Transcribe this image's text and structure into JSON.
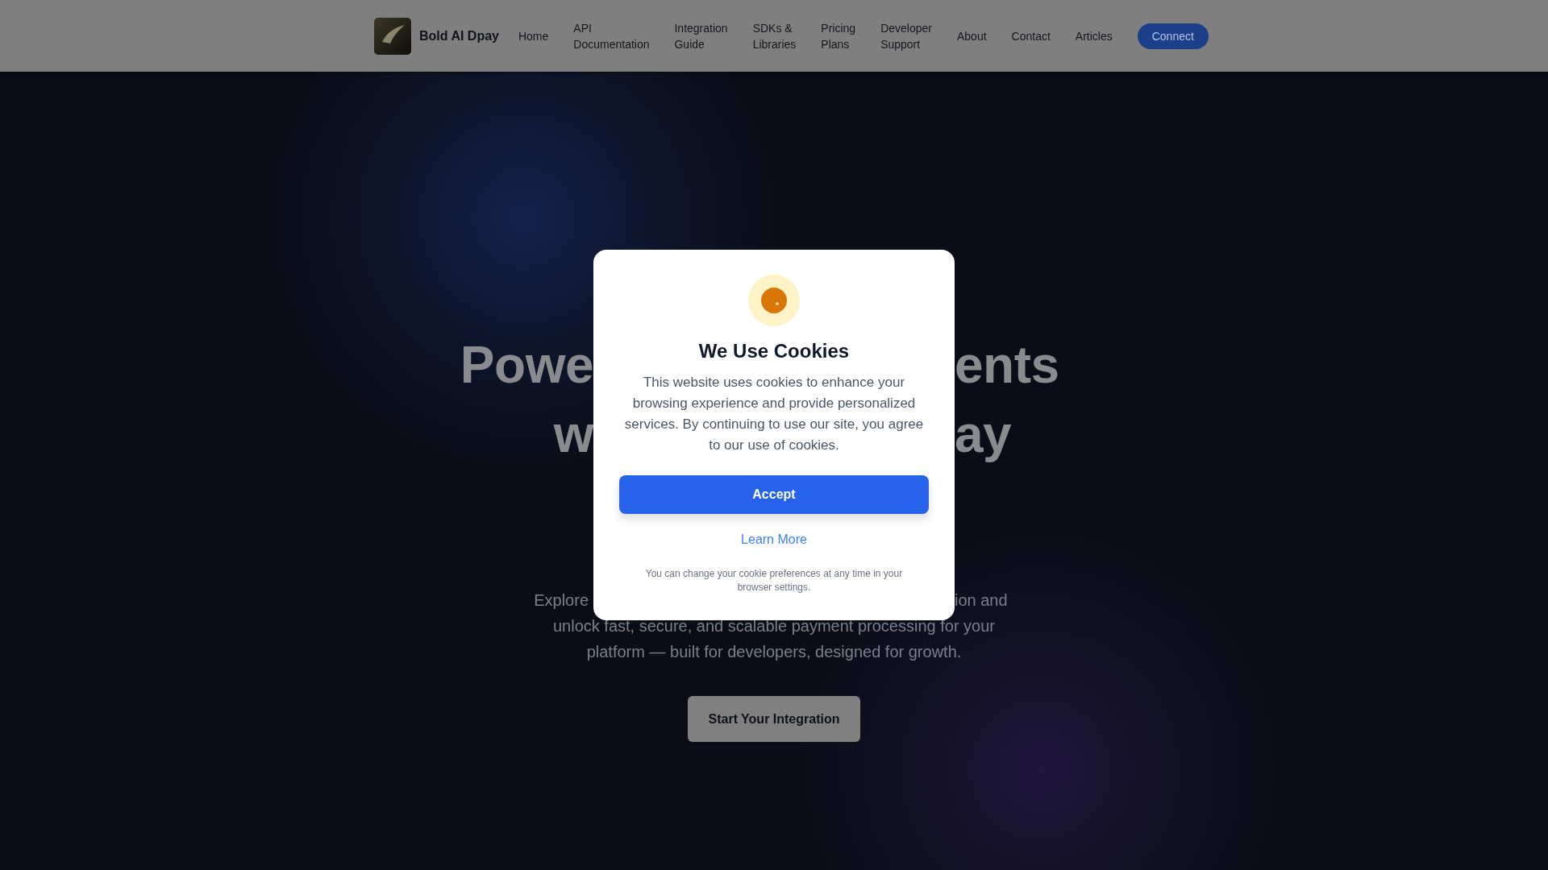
{
  "navbar": {
    "brand": "Bold AI Dpay",
    "links": [
      "Home",
      "API Documentation",
      "Integration Guide",
      "SDKs & Libraries",
      "Pricing Plans",
      "Developer Support",
      "About",
      "Contact",
      "Articles"
    ],
    "cta_button": "Connect"
  },
  "hero": {
    "title_fragments": [
      {
        "left": "Powe",
        "right": "ents"
      },
      {
        "left": "w",
        "right": "ay"
      }
    ],
    "description_fragment": {
      "left": "Explore",
      "right": "ion and"
    },
    "description_lines": [
      "unlock fast, secure, and scalable payment processing for your",
      "platform — built for developers, designed for growth."
    ],
    "button": "Start Your Integration"
  },
  "cookie_dialog": {
    "title": "We Use Cookies",
    "message": "This website uses cookies to enhance your browsing experience and provide personalized services. By continuing to use our site, you agree to our use of cookies.",
    "accept_button": "Accept",
    "learn_more_link": "Learn More",
    "footnote": "You can change your cookie preferences at any time in your browser settings."
  }
}
